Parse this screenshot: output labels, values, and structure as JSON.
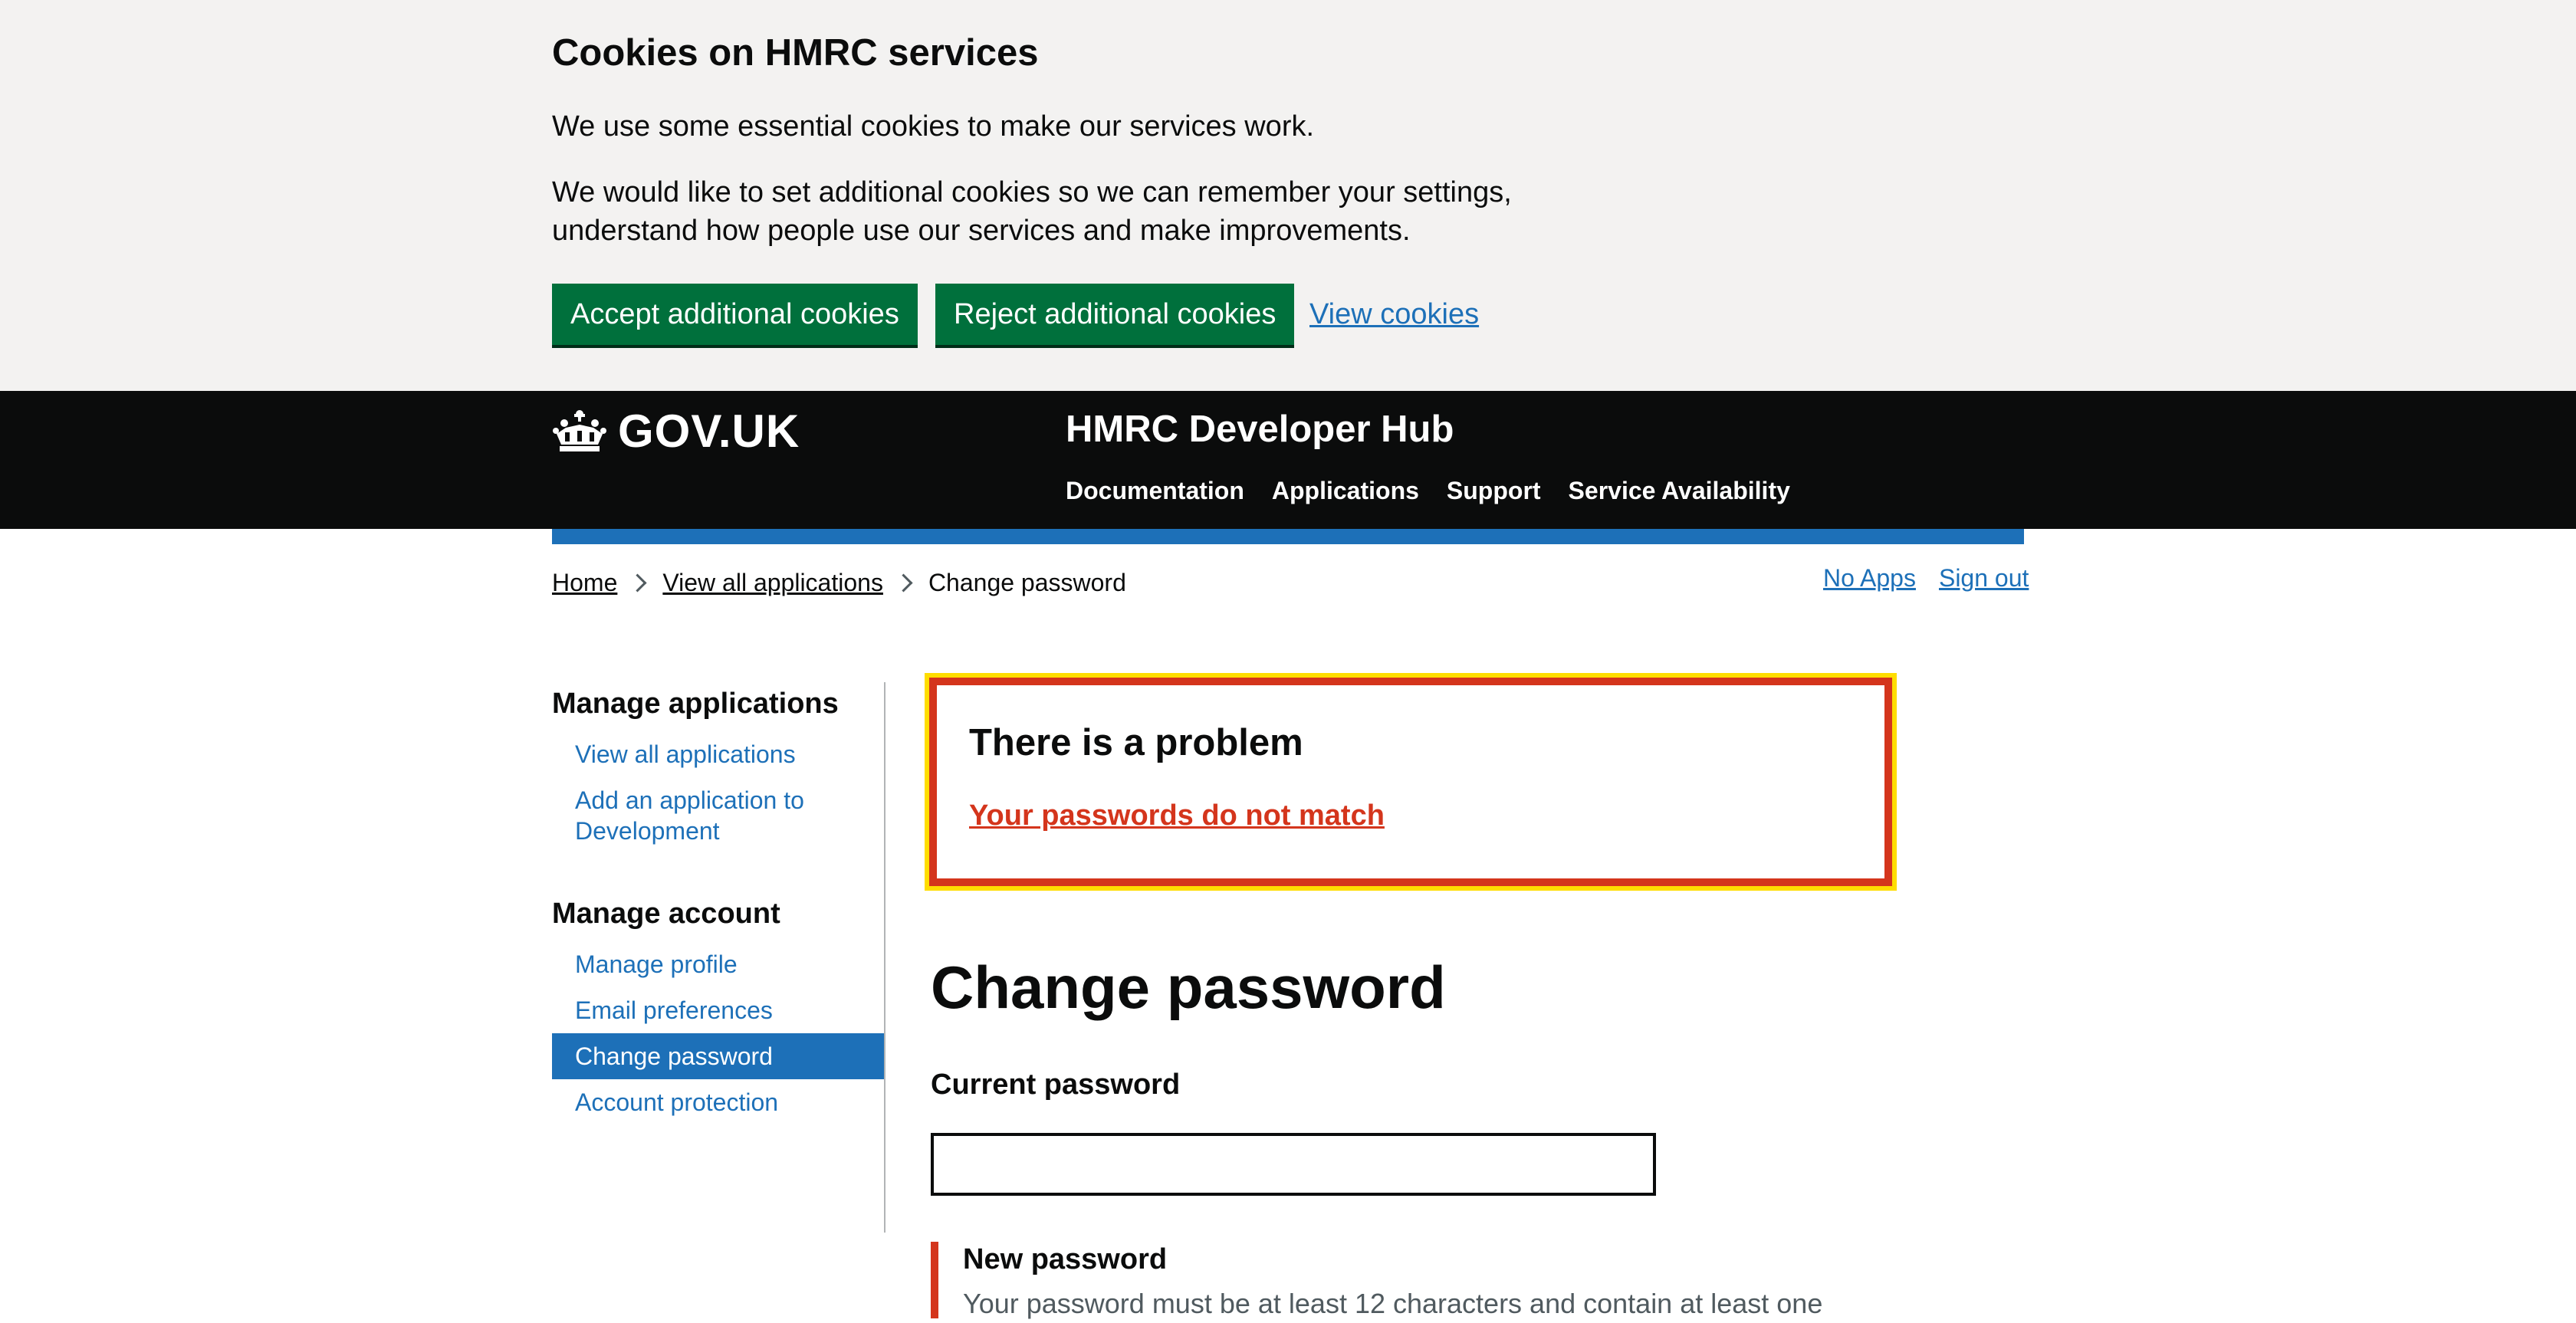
{
  "cookie_banner": {
    "title": "Cookies on HMRC services",
    "paragraph_1": "We use some essential cookies to make our services work.",
    "paragraph_2": "We would like to set additional cookies so we can remember your settings, understand how people use our services and make improvements.",
    "accept_label": "Accept additional cookies",
    "reject_label": "Reject additional cookies",
    "view_label": "View cookies",
    "background": "#f3f2f1",
    "button_color": "#00703c"
  },
  "header": {
    "logo_text": "GOV.UK",
    "logo_icon": "crown-icon",
    "service_name": "HMRC Developer Hub",
    "nav": [
      "Documentation",
      "Applications",
      "Support",
      "Service Availability"
    ],
    "background": "#0b0c0c",
    "accent_bar": "#1d70b8"
  },
  "breadcrumb": {
    "items": [
      "Home",
      "View all applications"
    ],
    "current": "Change password"
  },
  "top_links": {
    "no_apps": "No Apps",
    "sign_out": "Sign out"
  },
  "sidebar": {
    "sections": [
      {
        "heading": "Manage applications",
        "items": [
          "View all applications",
          "Add an application to Development"
        ]
      },
      {
        "heading": "Manage account",
        "items": [
          "Manage profile",
          "Email preferences",
          "Change password",
          "Account protection"
        ]
      }
    ],
    "active_item": "Change password",
    "link_color": "#1d70b8"
  },
  "error_summary": {
    "title": "There is a problem",
    "message": "Your passwords do not match",
    "border_color": "#d4351c",
    "focus_color": "#ffdd00"
  },
  "form": {
    "title": "Change password",
    "current_password_label": "Current password",
    "current_password_value": "",
    "new_password_label": "New password",
    "new_password_hint": "Your password must be at least 12 characters and contain at least one"
  }
}
